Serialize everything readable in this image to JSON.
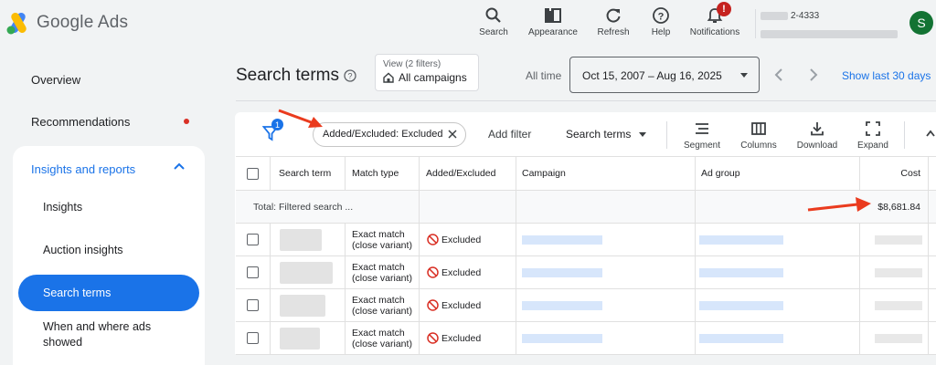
{
  "app": {
    "name": "Google Ads"
  },
  "header_tools": [
    {
      "label": "Search",
      "icon": "search-icon"
    },
    {
      "label": "Appearance",
      "icon": "appearance-icon"
    },
    {
      "label": "Refresh",
      "icon": "refresh-icon"
    },
    {
      "label": "Help",
      "icon": "help-icon"
    },
    {
      "label": "Notifications",
      "icon": "bell-icon",
      "badge": "!"
    }
  ],
  "account": {
    "id_suffix": "2-4333",
    "avatar_letter": "S"
  },
  "sidebar": {
    "overview": "Overview",
    "recommendations": "Recommendations",
    "group": "Insights and reports",
    "items": [
      "Insights",
      "Auction insights",
      "Search terms",
      "When and where ads showed"
    ],
    "active": "Search terms"
  },
  "page": {
    "title": "Search terms",
    "view_label": "View (2 filters)",
    "view_value": "All campaigns",
    "all_time": "All time",
    "date_range": "Oct 15, 2007 – Aug 16, 2025",
    "show_last": "Show last 30 days"
  },
  "toolbar": {
    "filter_count": "1",
    "chip": "Added/Excluded: Excluded",
    "add_filter": "Add filter",
    "search_terms": "Search terms",
    "segment": "Segment",
    "columns": "Columns",
    "download": "Download",
    "expand": "Expand"
  },
  "table": {
    "headers": [
      "Search term",
      "Match type",
      "Added/Excluded",
      "Campaign",
      "Ad group",
      "Cost"
    ],
    "total_label": "Total: Filtered search ...",
    "total_cost": "$8,681.84",
    "rows": [
      {
        "match_type_1": "Exact match",
        "match_type_2": "(close variant)",
        "status": "Excluded"
      },
      {
        "match_type_1": "Exact match",
        "match_type_2": "(close variant)",
        "status": "Excluded"
      },
      {
        "match_type_1": "Exact match",
        "match_type_2": "(close variant)",
        "status": "Excluded"
      },
      {
        "match_type_1": "Exact match",
        "match_type_2": "(close variant)",
        "status": "Excluded"
      }
    ]
  },
  "colors": {
    "accent": "#1a73e8",
    "annotation_arrow": "#ea3b1e",
    "excluded": "#d93025"
  }
}
